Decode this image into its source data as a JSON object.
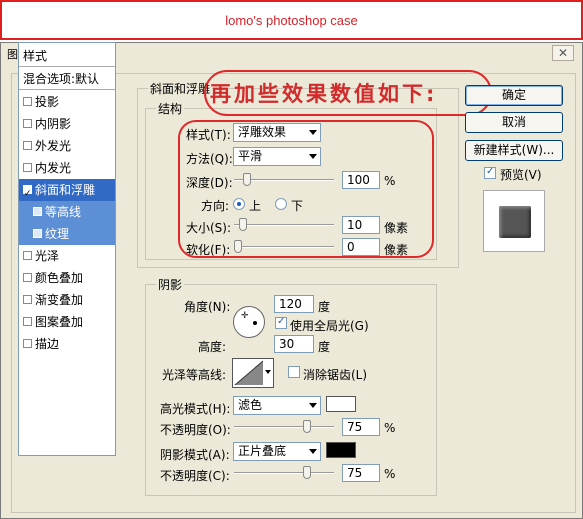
{
  "banner": {
    "text": "lomo's photoshop case"
  },
  "window": {
    "title": "图层样式",
    "close": "✕"
  },
  "left_panel": {
    "header": "样式",
    "blend": "混合选项:默认",
    "items": [
      {
        "label": "投影",
        "checked": false
      },
      {
        "label": "内阴影",
        "checked": false
      },
      {
        "label": "外发光",
        "checked": false
      },
      {
        "label": "内发光",
        "checked": false
      },
      {
        "label": "斜面和浮雕",
        "checked": true
      },
      {
        "label": "等高线",
        "checked": false
      },
      {
        "label": "纹理",
        "checked": false
      },
      {
        "label": "光泽",
        "checked": false
      },
      {
        "label": "颜色叠加",
        "checked": false
      },
      {
        "label": "渐变叠加",
        "checked": false
      },
      {
        "label": "图案叠加",
        "checked": false
      },
      {
        "label": "描边",
        "checked": false
      }
    ]
  },
  "bevel": {
    "group_title": "斜面和浮雕",
    "structure_title": "结构",
    "style_label": "样式(T):",
    "style_value": "浮雕效果",
    "method_label": "方法(Q):",
    "method_value": "平滑",
    "depth_label": "深度(D):",
    "depth_value": "100",
    "depth_unit": "%",
    "depth_slider": 0.1,
    "direction_label": "方向:",
    "up": "上",
    "down": "下",
    "size_label": "大小(S):",
    "size_value": "10",
    "size_unit": "像素",
    "size_slider": 0.05,
    "soften_label": "软化(F):",
    "soften_value": "0",
    "soften_unit": "像素",
    "soften_slider": 0
  },
  "shading": {
    "title": "阴影",
    "angle_label": "角度(N):",
    "angle_value": "120",
    "angle_unit": "度",
    "global_light": "使用全局光(G)",
    "altitude_label": "高度:",
    "altitude_value": "30",
    "altitude_unit": "度",
    "gloss_label": "光泽等高线:",
    "antialias": "消除锯齿(L)",
    "highlight_mode_label": "高光模式(H):",
    "highlight_mode": "滤色",
    "highlight_color": "#ffffff",
    "opacity1_label": "不透明度(O):",
    "opacity1_value": "75",
    "opacity1_unit": "%",
    "shadow_mode_label": "阴影模式(A):",
    "shadow_mode": "正片叠底",
    "shadow_color": "#000000",
    "opacity2_label": "不透明度(C):",
    "opacity2_value": "75",
    "opacity2_unit": "%"
  },
  "buttons": {
    "ok": "确定",
    "cancel": "取消",
    "new_style": "新建样式(W)...",
    "preview": "预览(V)"
  },
  "callout": "再加些效果数值如下:",
  "colors": {
    "accent_red": "#e0282a",
    "selection_blue": "#316ac5"
  }
}
